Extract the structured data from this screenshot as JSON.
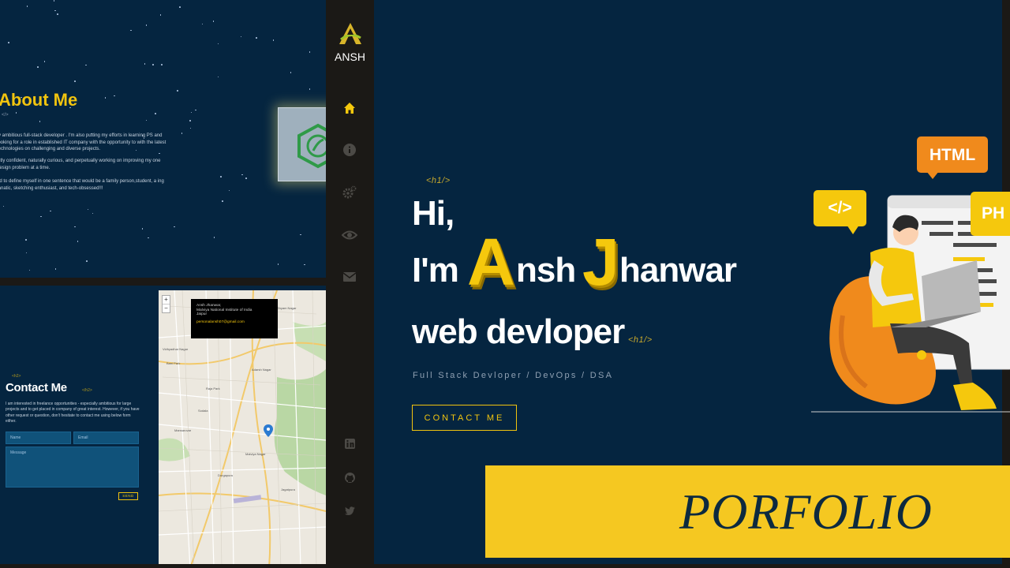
{
  "about": {
    "title": "About Me",
    "tag": "</>",
    "paragraphs": [
      "ry ambitious full-stack developer . I'm also putting my efforts in learning PS and looking for a role in established IT company with the opportunity to with the latest technologies on challenging and diverse projects.",
      "istly confident, naturally curious, and perpetually working on improving my one design problem at a time.",
      "ed to define myself in one sentence that would be a family person,student, a ing fanatic, sketching enthusiast, and tech-obsessed!!!"
    ]
  },
  "contact": {
    "tag_small": "<h2>",
    "title": "Contact Me",
    "tag_close": "</h2>",
    "description": "I am interested in freelance opportunities - especially ambitious for large projects and to get placed in company of great interest. However, if you have other request or question, don't hesitate to contact me using below form either.",
    "name_placeholder": "Name",
    "email_placeholder": "Email",
    "message_placeholder": "Message",
    "send_label": "SEND"
  },
  "map": {
    "zoom_in": "+",
    "zoom_out": "−",
    "popup": {
      "name": "Ansh Jhanwar,",
      "institute": "Malviya National Institute of India",
      "city": "Jaipur",
      "email": "personalansh07@gmail.com"
    },
    "labels": [
      "Bani Park",
      "Adarsh Nagar",
      "Raja Park",
      "Malviya Nagar",
      "Jagatpura",
      "Mansarovar",
      "Durgapura",
      "Sodala",
      "Shyam Nagar",
      "Vidhyadhar Nagar"
    ]
  },
  "sidebar": {
    "logo_text": "ANSH",
    "nav": [
      {
        "icon": "home-icon",
        "active": true
      },
      {
        "icon": "info-icon",
        "active": false
      },
      {
        "icon": "settings-icon",
        "active": false
      },
      {
        "icon": "eye-icon",
        "active": false
      },
      {
        "icon": "mail-icon",
        "active": false
      }
    ],
    "social": [
      "linkedin-icon",
      "github-icon",
      "twitter-icon"
    ]
  },
  "hero": {
    "tag_open": "<h1/>",
    "greeting": "Hi,",
    "im": "I'm",
    "first_initial": "A",
    "first_rest": "nsh",
    "last_initial": "J",
    "last_rest": "hanwar",
    "role": "web devloper",
    "tag_close": "<h1/>",
    "subtitle": "Full Stack Devloper / DevOps / DSA",
    "cta_label": "CONTACT ME"
  },
  "illustration": {
    "bubble_html": "HTML",
    "bubble_code": "</>",
    "bubble_php": "PH"
  },
  "banner": {
    "text": "PORFOLIO"
  },
  "colors": {
    "accent": "#f1c40f",
    "background": "#052540",
    "sidebar": "#1b1916",
    "banner": "#f5c821"
  }
}
